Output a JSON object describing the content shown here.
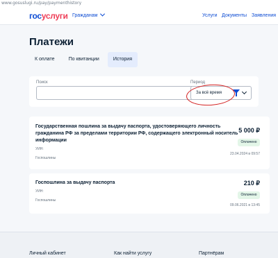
{
  "browser": {
    "url": "www.gosuslugi.ru/pay/paymenthistory"
  },
  "header": {
    "logo_part1": "гос",
    "logo_part2": "услуги",
    "audience": "Гражданам",
    "nav": [
      "Услуги",
      "Документы",
      "Заявления"
    ]
  },
  "page": {
    "title": "Платежи"
  },
  "tabs": [
    {
      "label": "К оплате"
    },
    {
      "label": "По квитанции"
    },
    {
      "label": "История"
    }
  ],
  "filter": {
    "search_label": "Поиск",
    "period_label": "Период",
    "period_value": "За всё время"
  },
  "payments": [
    {
      "title": "Государственная пошлина за выдачу паспорта, удостоверяющего личность гражданина РФ за пределами территории РФ, содержащего электронный носитель информации",
      "amount": "5 000 ₽",
      "status": "Оплачено",
      "uin_label": "УИН:",
      "payee": "Госпошлины",
      "date": "23.04.2024 в 09:57"
    },
    {
      "title": "Госпошлина за выдачу паспорта",
      "amount": "210 ₽",
      "status": "Оплачено",
      "uin_label": "УИН:",
      "payee": "Госпошлины",
      "date": "09.06.2021 в 13:45"
    }
  ],
  "footer": {
    "links": [
      "Личный кабинет",
      "Как найти услугу",
      "Партнёрам"
    ]
  },
  "colors": {
    "brand_blue": "#0d4cd3",
    "brand_red": "#ee3f58",
    "paid_bg": "#e3f6e8"
  }
}
